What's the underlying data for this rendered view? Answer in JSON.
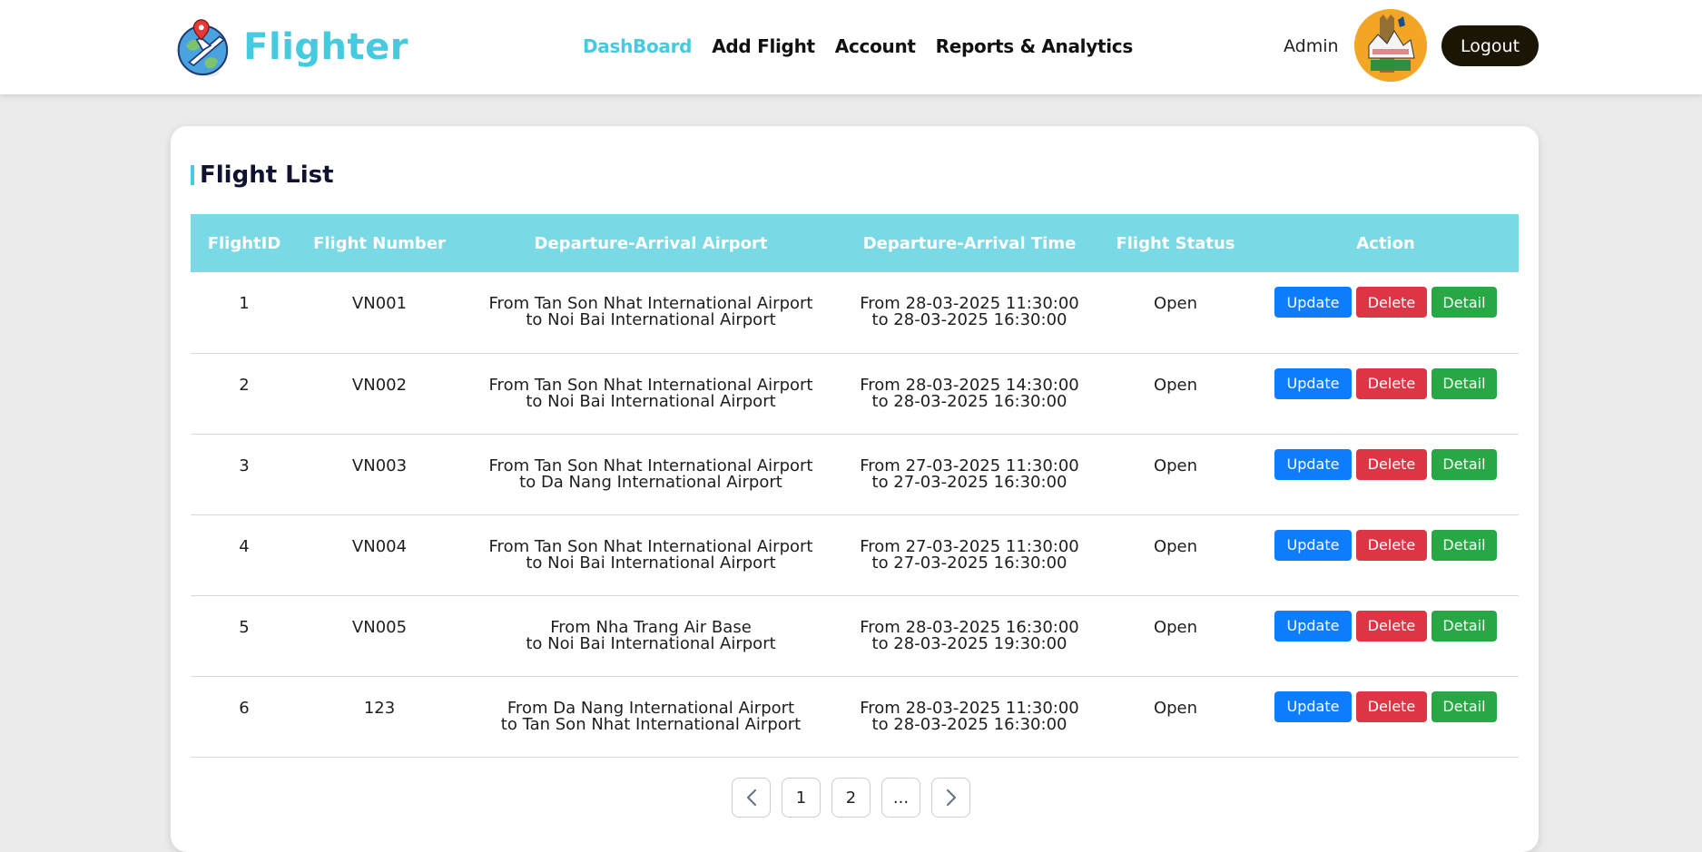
{
  "app": {
    "brand": "Flighter",
    "accent_color": "#45cbe0"
  },
  "nav": {
    "items": [
      {
        "label": "DashBoard",
        "active": true
      },
      {
        "label": "Add Flight",
        "active": false
      },
      {
        "label": "Account",
        "active": false
      },
      {
        "label": "Reports & Analytics",
        "active": false
      }
    ]
  },
  "user": {
    "name": "Admin",
    "logout_label": "Logout"
  },
  "main": {
    "title": "Flight List",
    "columns": [
      "FlightID",
      "Flight Number",
      "Departure-Arrival Airport",
      "Departure-Arrival Time",
      "Flight Status",
      "Action"
    ],
    "actions": {
      "update": "Update",
      "delete": "Delete",
      "detail": "Detail"
    },
    "rows": [
      {
        "id": "1",
        "number": "VN001",
        "route_from": "From Tan Son Nhat International Airport",
        "route_to": "to Noi Bai International Airport",
        "time_from": "From 28-03-2025 11:30:00",
        "time_to": "to 28-03-2025 16:30:00",
        "status": "Open"
      },
      {
        "id": "2",
        "number": "VN002",
        "route_from": "From Tan Son Nhat International Airport",
        "route_to": "to Noi Bai International Airport",
        "time_from": "From 28-03-2025 14:30:00",
        "time_to": "to 28-03-2025 16:30:00",
        "status": "Open"
      },
      {
        "id": "3",
        "number": "VN003",
        "route_from": "From Tan Son Nhat International Airport",
        "route_to": "to Da Nang International Airport",
        "time_from": "From 27-03-2025 11:30:00",
        "time_to": "to 27-03-2025 16:30:00",
        "status": "Open"
      },
      {
        "id": "4",
        "number": "VN004",
        "route_from": "From Tan Son Nhat International Airport",
        "route_to": "to Noi Bai International Airport",
        "time_from": "From 27-03-2025 11:30:00",
        "time_to": "to 27-03-2025 16:30:00",
        "status": "Open"
      },
      {
        "id": "5",
        "number": "VN005",
        "route_from": "From Nha Trang Air Base",
        "route_to": "to Noi Bai International Airport",
        "time_from": "From 28-03-2025 16:30:00",
        "time_to": "to 28-03-2025 19:30:00",
        "status": "Open"
      },
      {
        "id": "6",
        "number": "123",
        "route_from": "From Da Nang International Airport",
        "route_to": "to Tan Son Nhat International Airport",
        "time_from": "From 28-03-2025 11:30:00",
        "time_to": "to 28-03-2025 16:30:00",
        "status": "Open"
      }
    ]
  },
  "pagination": {
    "prev_icon": "chevron-left-icon",
    "pages": [
      "1",
      "2",
      "..."
    ],
    "next_icon": "chevron-right-icon"
  },
  "colors": {
    "header_row": "#79d9e5",
    "update_button": "#0d7dfd",
    "delete_button": "#dd3545",
    "detail_button": "#28a745",
    "logout_button": "#1a1505"
  }
}
